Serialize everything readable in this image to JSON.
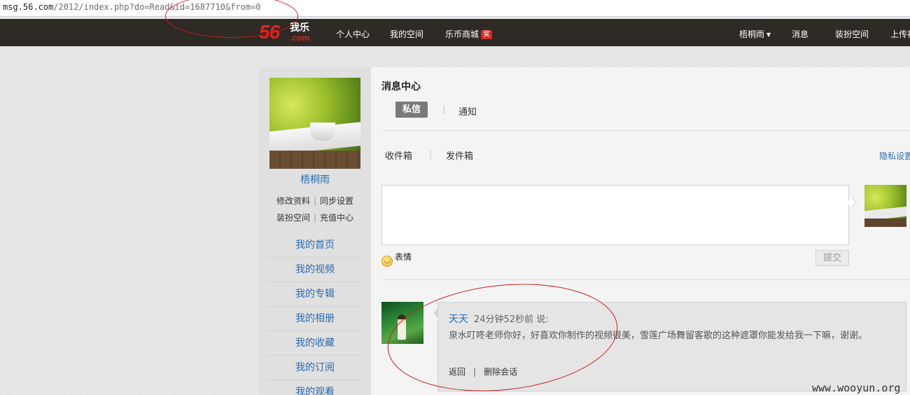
{
  "address_bar": {
    "host": "msg.56.com",
    "path": "/2012/index.php?do=Read&id=1687710&from=0"
  },
  "topnav": {
    "logo_number": "56",
    "logo_text": "我乐",
    "logo_suffix": ".com",
    "items": [
      "个人中心",
      "我的空间",
      "乐币商城"
    ],
    "shop_badge": "奖",
    "username": "梧桐雨",
    "right_items": [
      "消息",
      "装扮空间",
      "上传视频"
    ]
  },
  "sidebar": {
    "username": "梧桐雨",
    "links_row1": [
      "修改资料",
      "同步设置"
    ],
    "links_row2": [
      "装扮空间",
      "充值中心"
    ],
    "menu": [
      "我的首页",
      "我的视频",
      "我的专辑",
      "我的相册",
      "我的收藏",
      "我的订阅",
      "我的观看"
    ]
  },
  "main": {
    "title": "消息中心",
    "tabs": [
      {
        "label": "私信",
        "active": true
      },
      {
        "label": "通知",
        "active": false
      }
    ],
    "subtabs": [
      "收件箱",
      "发件箱"
    ],
    "privacy_link": "隐私设置",
    "compose": {
      "placeholder": "",
      "emoji_label": "表情",
      "submit_label": "提交"
    },
    "message": {
      "sender": "天天",
      "time": "24分钟52秒前",
      "says": "说:",
      "body": "泉水叮咚老师你好，好喜欢你制作的视频很美，雪莲广场舞留客歌的这种遮罩你能发给我一下嘛，谢谢。",
      "actions": [
        "返回",
        "删除会话"
      ]
    }
  },
  "watermark": "www.wooyun.org",
  "colors": {
    "nav_bg": "#2e2a26",
    "brand_red": "#e2231a",
    "link_blue": "#2b6cb0",
    "annotation_red": "#cc1b1b"
  }
}
